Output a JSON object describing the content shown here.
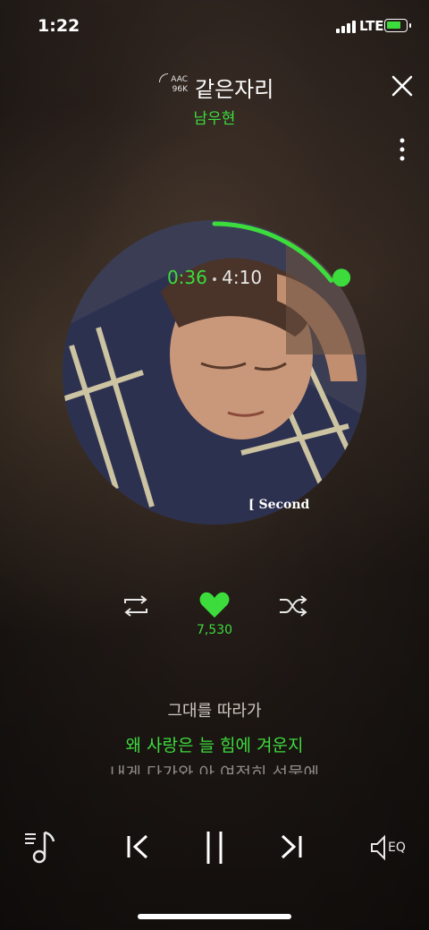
{
  "status_bar": {
    "time": "1:22",
    "network": "LTE",
    "battery_charging": true,
    "battery_color": "#3ddc3d"
  },
  "header": {
    "codec_line1": "AAC",
    "codec_line2": "96K",
    "title": "같은자리",
    "artist": "남우현",
    "close_icon": "close-icon",
    "more_icon": "more-vertical-icon"
  },
  "player": {
    "current_time": "0:36",
    "total_time": "4:10",
    "progress_fraction": 0.144,
    "album_text": "[ Second",
    "accent_color": "#3ddc3d"
  },
  "actions": {
    "repeat_icon": "repeat-icon",
    "like_icon": "heart-icon",
    "like_count": "7,530",
    "shuffle_icon": "shuffle-icon"
  },
  "lyrics": {
    "previous": "그대를 따라가",
    "current": "왜 사랑은 늘 힘에 겨운지",
    "next": "내게 다가와 아 여전히 선물에"
  },
  "bottom_controls": {
    "playlist_icon": "playlist-icon",
    "prev_icon": "previous-track-icon",
    "pause_icon": "pause-icon",
    "next_icon": "next-track-icon",
    "eq_label": "EQ"
  }
}
